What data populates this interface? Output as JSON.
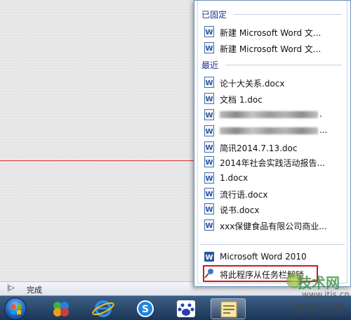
{
  "jumplist": {
    "pinned_header": "已固定",
    "pinned": [
      {
        "label": "新建 Microsoft Word 文...",
        "icon": "word-doc-icon"
      },
      {
        "label": "新建 Microsoft Word 文...",
        "icon": "word-doc-icon"
      }
    ],
    "recent_header": "最近",
    "recent": [
      {
        "label": "论十大关系.docx",
        "icon": "word-doc-icon"
      },
      {
        "label": "文档 1.doc",
        "icon": "word-doc-icon"
      },
      {
        "label": "",
        "icon": "word-doc-icon",
        "blurred": true,
        "suffix": "."
      },
      {
        "label": "",
        "icon": "word-doc-icon",
        "blurred": true,
        "suffix": "..."
      },
      {
        "label": "简讯2014.7.13.doc",
        "icon": "word-doc-icon"
      },
      {
        "label": "2014年社会实践活动报告...",
        "icon": "word-doc-icon"
      },
      {
        "label": "1.docx",
        "icon": "word-doc-icon"
      },
      {
        "label": "流行语.docx",
        "icon": "word-doc-icon"
      },
      {
        "label": "说书.docx",
        "icon": "word-doc-icon"
      },
      {
        "label": "xxx保健食品有限公司商业...",
        "icon": "word-doc-icon"
      }
    ],
    "app_item": {
      "label": "Microsoft Word 2010",
      "icon": "word-app-icon"
    },
    "unpin_item": {
      "label": "将此程序从任务栏解锁",
      "icon": "unpin-icon"
    }
  },
  "statusbar": {
    "status_text": "完成"
  },
  "taskbar": {
    "buttons": [
      "start-orb",
      "media-center",
      "internet-explorer",
      "sogou",
      "baidu",
      "word"
    ]
  },
  "watermark": {
    "title": "技术网",
    "url": "www.itjs.cn",
    "subtitle": "脚本之家"
  },
  "colors": {
    "header_blue": "#1e3287",
    "highlight_red": "#d11a1a",
    "taskbar_top": "#3d5f86",
    "guide_line": "#dd3333"
  }
}
